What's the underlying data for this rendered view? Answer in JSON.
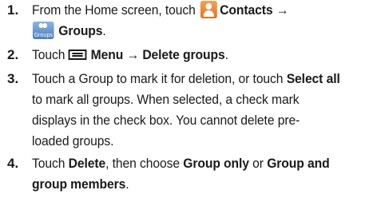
{
  "steps": [
    {
      "number": "1.",
      "line1_pre": "From the Home screen, touch",
      "contacts_label": "Contacts",
      "arrow": "→",
      "groups_icon_caption": "Groups",
      "groups_label": "Groups",
      "line2_end": "."
    },
    {
      "number": "2.",
      "pre": "Touch",
      "menu_label": "Menu",
      "arrow": "→",
      "action": "Delete groups",
      "end": "."
    },
    {
      "number": "3.",
      "line1_pre": "Touch a Group to mark it for deletion, or touch",
      "select_all": "Select all",
      "line2": "to mark all groups. When selected, a check mark",
      "line3": "displays in the check box. You cannot delete pre-",
      "line4": "loaded groups."
    },
    {
      "number": "4.",
      "pre": "Touch",
      "delete": "Delete",
      "mid1": ", then choose",
      "group_only": "Group only",
      "mid2": "or",
      "group_and": "Group and",
      "group_members": "group members",
      "end": "."
    }
  ],
  "icons": {
    "contacts": "contacts-icon",
    "groups": "groups-icon",
    "menu": "menu-icon"
  },
  "colors": {
    "contacts_icon": "#e0721f",
    "groups_icon": "#4f7fbd",
    "text": "#1a1a1a"
  }
}
